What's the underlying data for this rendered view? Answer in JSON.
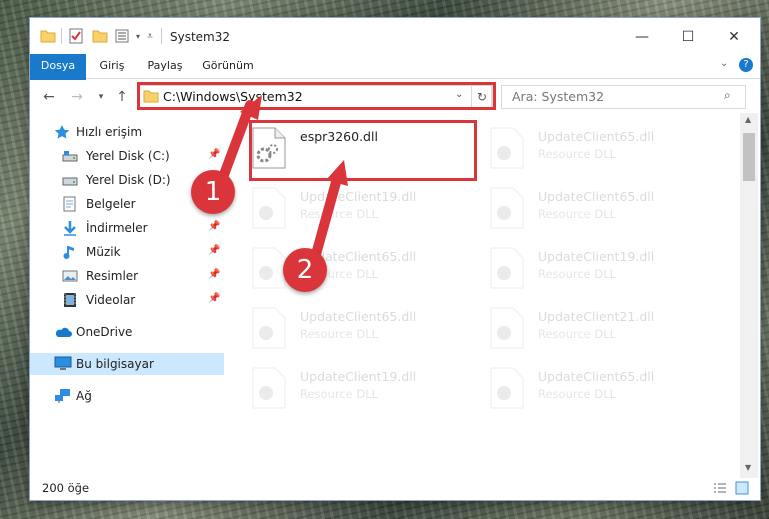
{
  "window": {
    "title": "System32",
    "controls": {
      "minimize": "—",
      "maximize": "☐",
      "close": "✕"
    }
  },
  "ribbon": {
    "tabs": [
      "Dosya",
      "Giriş",
      "Paylaş",
      "Görünüm"
    ],
    "accent": "#1979ca"
  },
  "navigation": {
    "address": "C:\\Windows\\System32",
    "search_placeholder": "Ara: System32"
  },
  "sidebar": {
    "items": [
      {
        "label": "Hızlı erişim",
        "icon": "star-icon"
      },
      {
        "label": "Yerel Disk (C:)",
        "icon": "drive-icon",
        "pinned": true
      },
      {
        "label": "Yerel Disk (D:)",
        "icon": "drive-icon"
      },
      {
        "label": "Belgeler",
        "icon": "documents-icon"
      },
      {
        "label": "İndirmeler",
        "icon": "download-icon",
        "pinned": true
      },
      {
        "label": "Müzik",
        "icon": "music-icon",
        "pinned": true
      },
      {
        "label": "Resimler",
        "icon": "pictures-icon",
        "pinned": true
      },
      {
        "label": "Videolar",
        "icon": "videos-icon",
        "pinned": true
      },
      {
        "label": "OneDrive",
        "icon": "onedrive-icon"
      },
      {
        "label": "Bu bilgisayar",
        "icon": "computer-icon",
        "selected": true
      },
      {
        "label": "Ağ",
        "icon": "network-icon"
      }
    ]
  },
  "files": [
    {
      "name": "espr3260.dll",
      "type": "",
      "highlighted": true
    },
    {
      "name": "UpdateClient65.dll",
      "type": "Resource DLL"
    },
    {
      "name": "UpdateClient19.dll",
      "type": "Resource DLL"
    },
    {
      "name": "UpdateClient65.dll",
      "type": "Resource DLL"
    },
    {
      "name": "UpdateClient65.dll",
      "type": "Resource DLL"
    },
    {
      "name": "UpdateClient19.dll",
      "type": "Resource DLL"
    },
    {
      "name": "UpdateClient65.dll",
      "type": "Resource DLL"
    },
    {
      "name": "UpdateClient21.dll",
      "type": "Resource DLL"
    },
    {
      "name": "UpdateClient19.dll",
      "type": "Resource DLL"
    },
    {
      "name": "UpdateClient65.dll",
      "type": "Resource DLL"
    }
  ],
  "status": {
    "item_count": "200 öğe"
  },
  "annotations": {
    "step1": "1",
    "step2": "2",
    "color": "#d9353a"
  }
}
